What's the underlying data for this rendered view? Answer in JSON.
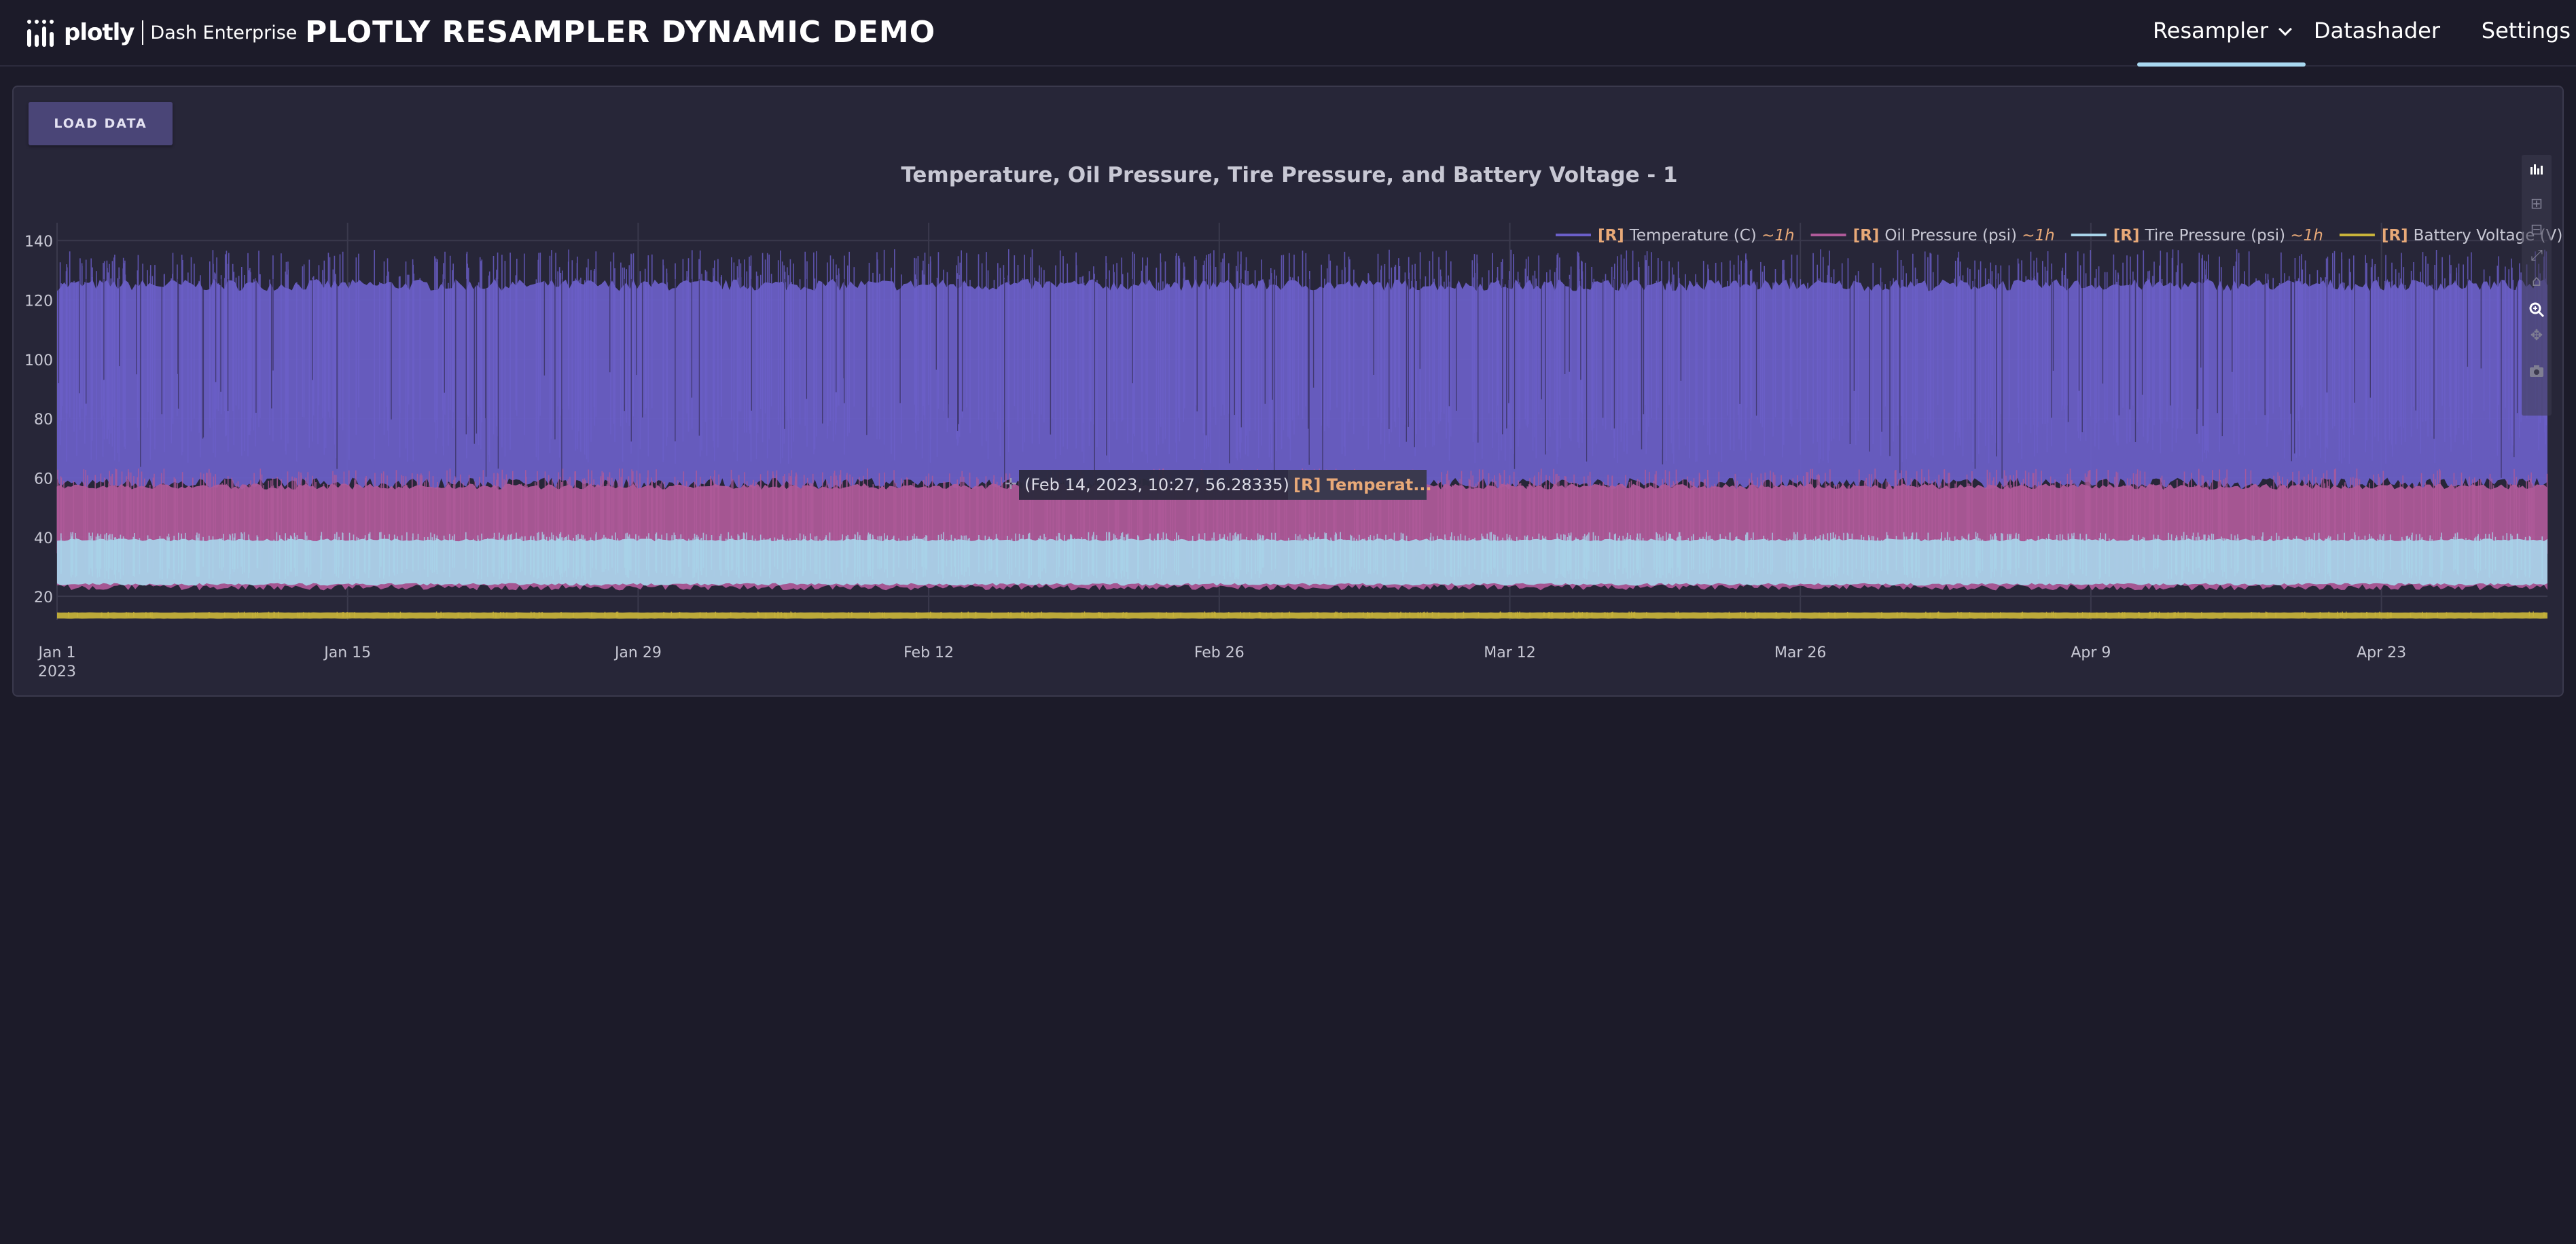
{
  "header": {
    "logo_word": "plotly",
    "logo_sub": "Dash Enterprise",
    "title": "PLOTLY RESAMPLER DYNAMIC DEMO",
    "nav": [
      {
        "label": "Resampler",
        "active": true,
        "dropdown": true
      },
      {
        "label": "Datashader",
        "active": false
      },
      {
        "label": "Settings",
        "active": false
      }
    ]
  },
  "card": {
    "load_button": "LOAD DATA"
  },
  "modebar": [
    "plotly-logo-icon",
    "zoom-in-icon",
    "zoom-out-icon",
    "autoscale-icon",
    "home-icon",
    "zoom-icon",
    "pan-icon",
    "camera-icon"
  ],
  "hover": {
    "text": "(Feb 14, 2023, 10:27, 56.28335)",
    "series": "[R] Temperat..."
  },
  "chart_data": {
    "type": "line",
    "title": "Temperature, Oil Pressure, Tire Pressure, and Battery Voltage - 1",
    "x_range": [
      "2023-01-01",
      "2023-05-01"
    ],
    "ylim": [
      12,
      146
    ],
    "x_ticks": [
      {
        "date": "2023-01-01",
        "label": "Jan 1",
        "sublabel": "2023"
      },
      {
        "date": "2023-01-15",
        "label": "Jan 15"
      },
      {
        "date": "2023-01-29",
        "label": "Jan 29"
      },
      {
        "date": "2023-02-12",
        "label": "Feb 12"
      },
      {
        "date": "2023-02-26",
        "label": "Feb 26"
      },
      {
        "date": "2023-03-12",
        "label": "Mar 12"
      },
      {
        "date": "2023-03-26",
        "label": "Mar 26"
      },
      {
        "date": "2023-04-09",
        "label": "Apr 9"
      },
      {
        "date": "2023-04-23",
        "label": "Apr 23"
      }
    ],
    "y_ticks": [
      20,
      40,
      60,
      80,
      100,
      120,
      140
    ],
    "grid": true,
    "legend_position": "top-right",
    "series": [
      {
        "name": "Temperature (C)",
        "prefix": "[R]",
        "suffix": "~1h",
        "color": "#6b5fc9",
        "band": [
          58,
          125
        ]
      },
      {
        "name": "Oil Pressure (psi)",
        "prefix": "[R]",
        "suffix": "~1h",
        "color": "#b05a9a",
        "band": [
          23,
          57
        ]
      },
      {
        "name": "Tire Pressure (psi)",
        "prefix": "[R]",
        "suffix": "~1h",
        "color": "#a8d4ea",
        "band": [
          24,
          39
        ]
      },
      {
        "name": "Battery Voltage (V)",
        "prefix": "[R]",
        "suffix": "~1h",
        "color": "#c9b43a",
        "band": [
          12.5,
          14.5
        ]
      }
    ],
    "colors": {
      "prefix": "#e8a978",
      "grid": "#3a394c",
      "text": "#c8c8d4"
    }
  }
}
